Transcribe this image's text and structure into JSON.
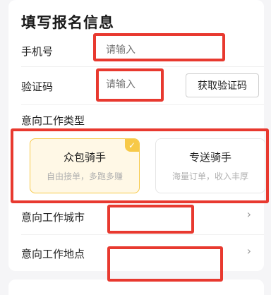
{
  "form": {
    "title": "填写报名信息",
    "phone": {
      "label": "手机号",
      "placeholder": "请输入"
    },
    "code": {
      "label": "验证码",
      "placeholder": "请输入",
      "button_label": "获取验证码"
    },
    "job_type": {
      "label": "意向工作类型",
      "options": [
        {
          "title": "众包骑手",
          "subtitle": "自由接单，多跑多赚",
          "selected": true
        },
        {
          "title": "专送骑手",
          "subtitle": "海量订单，收入丰厚",
          "selected": false
        }
      ]
    },
    "city": {
      "label": "意向工作城市",
      "value": ""
    },
    "location": {
      "label": "意向工作地点",
      "value": ""
    }
  },
  "colors": {
    "accent": "#f7c948",
    "highlight_border": "#e8392f",
    "placeholder": "#b5b5b5"
  },
  "icons": {
    "check": "check-icon",
    "chevron": "chevron-right-icon"
  }
}
